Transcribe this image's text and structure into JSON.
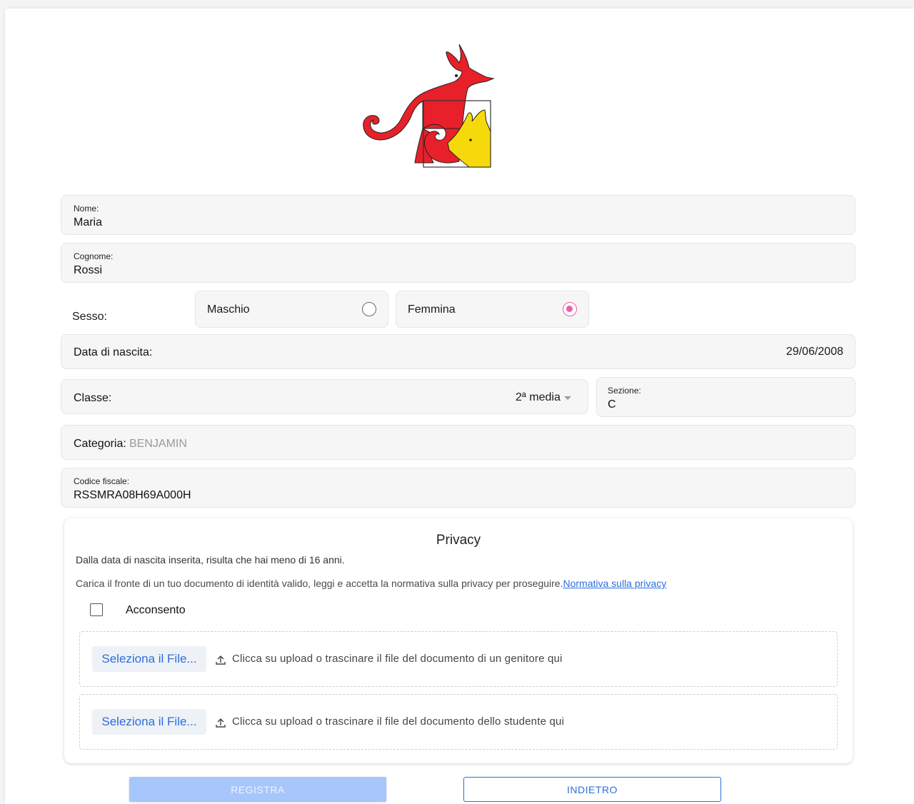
{
  "form": {
    "nome": {
      "label": "Nome:",
      "value": "Maria"
    },
    "cognome": {
      "label": "Cognome:",
      "value": "Rossi"
    },
    "sesso": {
      "label": "Sesso:",
      "options": [
        {
          "label": "Maschio",
          "checked": false
        },
        {
          "label": "Femmina",
          "checked": true
        }
      ]
    },
    "data_nascita": {
      "label": "Data di nascita:",
      "value": "29/06/2008"
    },
    "classe": {
      "label": "Classe:",
      "value": "2ª media"
    },
    "sezione": {
      "label": "Sezione:",
      "value": "C"
    },
    "categoria": {
      "label": "Categoria:",
      "value": "BENJAMIN"
    },
    "codice_fiscale": {
      "label": "Codice fiscale:",
      "value": "RSSMRA08H69A000H"
    }
  },
  "privacy": {
    "title": "Privacy",
    "warning": "Dalla data di nascita inserita, risulta che hai meno di 16 anni.",
    "instructions": "Carica il fronte di un tuo documento di identità valido, leggi e accetta la normativa sulla privacy per proseguire.",
    "link_label": "Normativa sulla privacy",
    "consent_label": "Acconsento",
    "consent_checked": false,
    "uploads": [
      {
        "button_label": "Seleziona il File...",
        "hint": "Clicca su upload o trascinare il file del documento di un genitore qui"
      },
      {
        "button_label": "Seleziona il File...",
        "hint": "Clicca su upload o trascinare il file del documento dello studente qui"
      }
    ]
  },
  "actions": {
    "registra_label": "REGISTRA",
    "indietro_label": "INDIETRO"
  },
  "colors": {
    "primary": "#2b6fdc",
    "radio_accent": "#ec5fb0",
    "disabled_button": "#a7c6fb",
    "logo_red": "#e8202a",
    "logo_yellow": "#f5d90a"
  }
}
